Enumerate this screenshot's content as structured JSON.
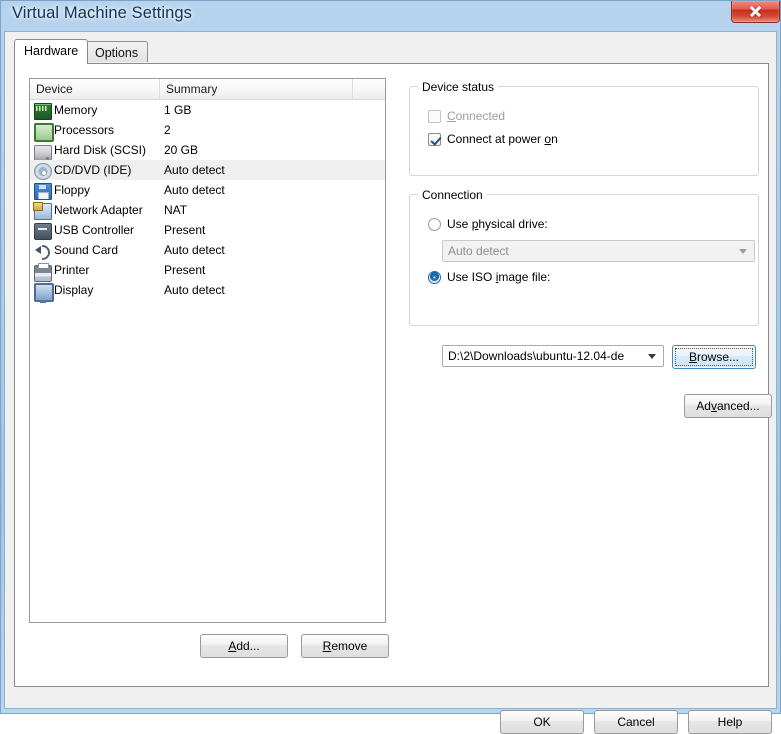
{
  "window": {
    "title": "Virtual Machine Settings",
    "close_icon": "close-icon"
  },
  "tabs": [
    {
      "label": "Hardware",
      "active": true
    },
    {
      "label": "Options",
      "active": false
    }
  ],
  "device_list": {
    "columns": [
      "Device",
      "Summary",
      ""
    ],
    "rows": [
      {
        "icon": "memory-icon",
        "name": "Memory",
        "summary": "1 GB",
        "selected": false
      },
      {
        "icon": "processor-icon",
        "name": "Processors",
        "summary": "2",
        "selected": false
      },
      {
        "icon": "hard-disk-icon",
        "name": "Hard Disk (SCSI)",
        "summary": "20 GB",
        "selected": false
      },
      {
        "icon": "cd-dvd-icon",
        "name": "CD/DVD (IDE)",
        "summary": "Auto detect",
        "selected": true
      },
      {
        "icon": "floppy-icon",
        "name": "Floppy",
        "summary": "Auto detect",
        "selected": false
      },
      {
        "icon": "network-adapter-icon",
        "name": "Network Adapter",
        "summary": "NAT",
        "selected": false
      },
      {
        "icon": "usb-controller-icon",
        "name": "USB Controller",
        "summary": "Present",
        "selected": false
      },
      {
        "icon": "sound-card-icon",
        "name": "Sound Card",
        "summary": "Auto detect",
        "selected": false
      },
      {
        "icon": "printer-icon",
        "name": "Printer",
        "summary": "Present",
        "selected": false
      },
      {
        "icon": "display-icon",
        "name": "Display",
        "summary": "Auto detect",
        "selected": false
      }
    ]
  },
  "list_buttons": {
    "add": {
      "before": "",
      "accel": "A",
      "after": "dd..."
    },
    "remove": {
      "before": "",
      "accel": "R",
      "after": "emove"
    }
  },
  "device_status": {
    "legend": "Device status",
    "connected": {
      "before": "",
      "accel": "C",
      "after": "onnected",
      "checked": false,
      "enabled": false
    },
    "connect_at_power_on": {
      "before": "Connect at power ",
      "accel": "o",
      "after": "n",
      "checked": true,
      "enabled": true
    }
  },
  "connection": {
    "legend": "Connection",
    "use_physical_drive": {
      "before": "Use ",
      "accel": "p",
      "after": "hysical drive:",
      "selected": false
    },
    "physical_drive_combo": {
      "value": "Auto detect",
      "enabled": false
    },
    "use_iso_image_file": {
      "before": "Use ISO ",
      "accel": "i",
      "after": "mage file:",
      "selected": true
    },
    "iso_combo": {
      "value": "D:\\2\\Downloads\\ubuntu-12.04-de",
      "enabled": true
    },
    "browse": {
      "before": "",
      "accel": "B",
      "after": "rowse..."
    }
  },
  "advanced_button": {
    "before": "Ad",
    "accel": "v",
    "after": "anced..."
  },
  "dialog_buttons": {
    "ok": "OK",
    "cancel": "Cancel",
    "help": "Help"
  }
}
